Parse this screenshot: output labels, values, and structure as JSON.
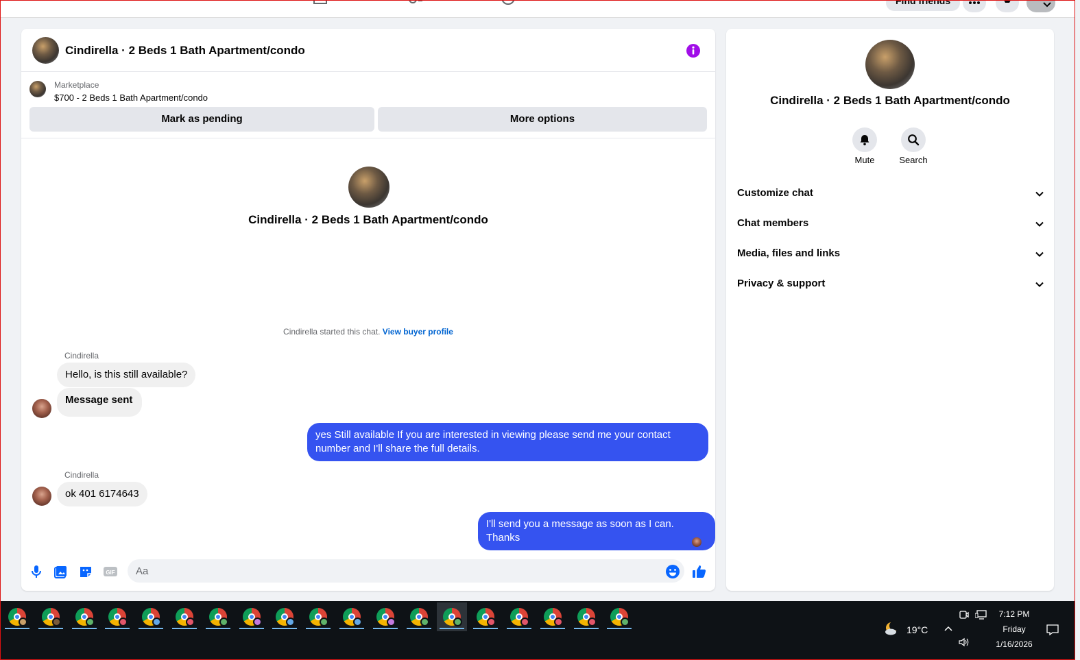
{
  "topnav": {
    "find_friends": "Find friends"
  },
  "chat": {
    "title": "Cindirella · 2 Beds 1 Bath Apartment/condo",
    "marketplace_label": "Marketplace",
    "listing": "$700 - 2 Beds 1 Bath Apartment/condo",
    "mark_pending": "Mark as pending",
    "more_options": "More options",
    "intro_name": "Cindirella · 2 Beds 1 Bath Apartment/condo",
    "started_text": "Cindirella started this chat. ",
    "view_buyer": "View buyer profile",
    "messages": [
      {
        "from": "Cindirella",
        "text": "Hello, is this still available?"
      },
      {
        "from": "Cindirella",
        "text": "Message sent"
      },
      {
        "from": "me",
        "text": "yes Still available If you are interested in viewing please send me your contact number and I'll share the full details."
      },
      {
        "from": "Cindirella",
        "text": "ok 401 6174643"
      },
      {
        "from": "me",
        "text": "I'll send you a message as soon as I can. Thanks"
      }
    ],
    "sender_name": "Cindirella",
    "input_placeholder": "Aa",
    "accent_color": "#3553f0"
  },
  "info_panel": {
    "name": "Cindirella · 2 Beds 1 Bath Apartment/condo",
    "mute_label": "Mute",
    "search_label": "Search",
    "sections": [
      {
        "label": "Customize chat"
      },
      {
        "label": "Chat members"
      },
      {
        "label": "Media, files and links"
      },
      {
        "label": "Privacy & support"
      }
    ]
  },
  "taskbar": {
    "weather": "19°C",
    "time": "7:12 PM",
    "day": "Friday",
    "date": "1/16/2026",
    "app_count": 19
  }
}
